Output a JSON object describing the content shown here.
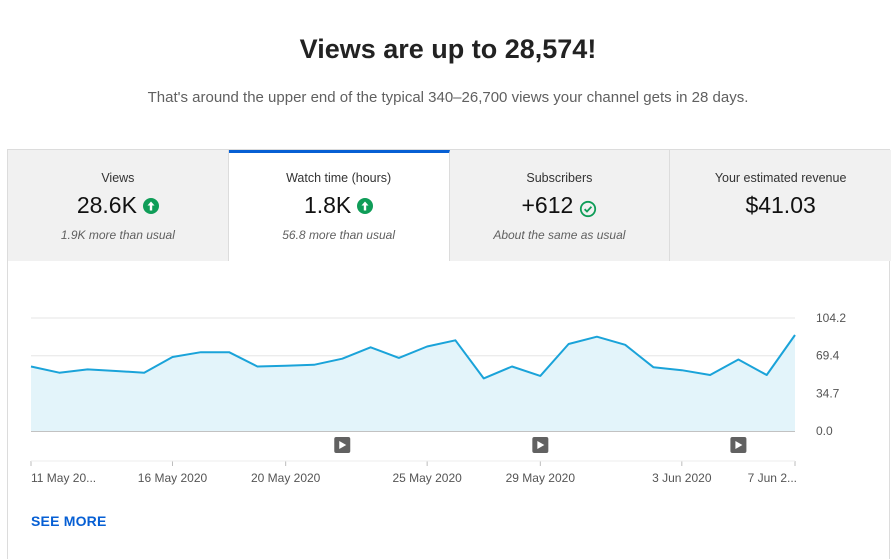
{
  "headline": "Views are up to 28,574!",
  "subline": "That's around the upper end of the typical 340–26,700 views your channel gets in 28 days.",
  "tabs": [
    {
      "label": "Views",
      "value": "28.6K",
      "note": "1.9K more than usual",
      "icon": "arrow-up-circle-icon",
      "active": false
    },
    {
      "label": "Watch time (hours)",
      "value": "1.8K",
      "note": "56.8 more than usual",
      "icon": "arrow-up-circle-icon",
      "active": true
    },
    {
      "label": "Subscribers",
      "value": "+612",
      "note": "About the same as usual",
      "icon": "check-circle-icon",
      "active": false
    },
    {
      "label": "Your estimated revenue",
      "value": "$41.03",
      "note": "",
      "icon": "",
      "active": false
    }
  ],
  "colors": {
    "accent": "#065fd4",
    "line": "#1aa3d9",
    "fill": "#e3f4fa",
    "up": "#0f9d58"
  },
  "chart_data": {
    "type": "area",
    "title": "",
    "xlabel": "",
    "ylabel": "",
    "ylim": [
      0,
      104.2
    ],
    "y_ticks": [
      "104.2",
      "69.4",
      "34.7",
      "0.0"
    ],
    "y_tick_values": [
      104.2,
      69.4,
      34.7,
      0.0
    ],
    "x_tick_labels": [
      "11 May 20...",
      "16 May 2020",
      "20 May 2020",
      "25 May 2020",
      "29 May 2020",
      "3 Jun 2020",
      "7 Jun 2..."
    ],
    "x_tick_indices": [
      0,
      5,
      9,
      14,
      18,
      23,
      27
    ],
    "series": [
      {
        "values": [
          59.5,
          53.8,
          56.8,
          55.3,
          53.8,
          68.2,
          72.7,
          72.7,
          59.5,
          60.2,
          61.0,
          66.7,
          77.2,
          67.4,
          77.9,
          83.6,
          48.5,
          59.5,
          50.8,
          80.2,
          87.0,
          79.5,
          58.7,
          56.1,
          51.6,
          65.9,
          51.6,
          88.5
        ]
      }
    ],
    "video_markers": [
      11,
      18,
      25
    ],
    "grid": true
  },
  "see_more": "SEE MORE"
}
